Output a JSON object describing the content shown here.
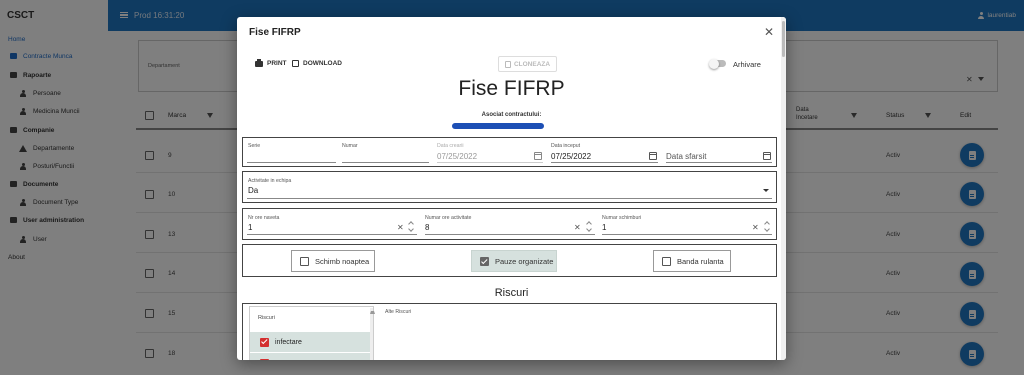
{
  "sidebar": {
    "brand": "CSCT",
    "items": [
      {
        "label": "Home"
      },
      {
        "label": "Contracte Munca"
      },
      {
        "label": "Rapoarte"
      },
      {
        "label": "Persoane"
      },
      {
        "label": "Medicina Muncii"
      },
      {
        "label": "Companie"
      },
      {
        "label": "Departamente"
      },
      {
        "label": "Posturi/Functii"
      },
      {
        "label": "Documente"
      },
      {
        "label": "Document Type"
      },
      {
        "label": "User administration"
      },
      {
        "label": "User"
      },
      {
        "label": "About"
      }
    ]
  },
  "topbar": {
    "title": "Prod 16:31:20",
    "user": "laurentiab"
  },
  "table": {
    "filter_label": "Departament",
    "headers": {
      "marca": "Marca",
      "data_incetare": "Data\nIncetare",
      "status": "Status",
      "edit": "Edit"
    },
    "rows": [
      {
        "marca": "9",
        "status": "Activ"
      },
      {
        "marca": "10",
        "status": "Activ"
      },
      {
        "marca": "13",
        "status": "Activ"
      },
      {
        "marca": "14",
        "status": "Activ"
      },
      {
        "marca": "15",
        "status": "Activ"
      },
      {
        "marca": "18",
        "status": "Activ"
      }
    ]
  },
  "modal": {
    "title": "Fise FIFRP",
    "print_label": "PRINT",
    "download_label": "DOWNLOAD",
    "clone_label": "CLONEAZA",
    "archive_label": "Arhivare",
    "heading": "Fise FIFRP",
    "asociat_label": "Asociat contractului:",
    "fields": {
      "serie": {
        "label": "Serie",
        "value": ""
      },
      "numar": {
        "label": "Numar",
        "value": ""
      },
      "data_creare": {
        "label": "Data crearii",
        "value": "07/25/2022"
      },
      "data_inceput": {
        "label": "Data inceput",
        "value": "07/25/2022"
      },
      "data_sfarsit": {
        "placeholder": "Data sfarsit"
      },
      "activitate": {
        "label": "Activitate in echipa",
        "value": "Da"
      },
      "nr_ore_naveta": {
        "label": "Nr ore naveta",
        "value": "1"
      },
      "numar_ore_activitate": {
        "label": "Numar ore activitate",
        "value": "8"
      },
      "numar_schimburi": {
        "label": "Numar schimburi",
        "value": "1"
      }
    },
    "checkboxes": [
      {
        "label": "Schimb noaptea",
        "checked": false
      },
      {
        "label": "Pauze organizate",
        "checked": true
      },
      {
        "label": "Banda rulanta",
        "checked": false
      }
    ],
    "riscuri_heading": "Riscuri",
    "riscuri_list_label": "Riscuri",
    "riscuri_items": [
      {
        "label": "infectare",
        "checked": true
      }
    ],
    "alte_riscuri_label": "Alte Riscuri"
  },
  "colors": {
    "primary": "#1e76c2",
    "checked_bg": "#d6e1de",
    "risk_check": "#d32f2f"
  }
}
